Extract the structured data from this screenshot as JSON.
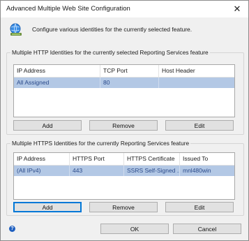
{
  "window": {
    "title": "Advanced Multiple Web Site Configuration",
    "close_glyph": "✕"
  },
  "header": {
    "icon": "globe-config-icon",
    "text": "Configure various identities for the currently selected feature."
  },
  "http_group": {
    "label": "Multiple HTTP Identities for the currently selected Reporting Services feature",
    "columns": [
      "IP Address",
      "TCP Port",
      "Host Header"
    ],
    "rows": [
      {
        "ip": "All Assigned",
        "port": "80",
        "host": ""
      }
    ],
    "add_label": "Add",
    "remove_label": "Remove",
    "edit_label": "Edit"
  },
  "https_group": {
    "label": "Multiple HTTPS Identities for the currently Reporting Services feature",
    "columns": [
      "IP Address",
      "HTTPS Port",
      "HTTPS Certificate",
      "Issued To"
    ],
    "rows": [
      {
        "ip": "(All IPv4)",
        "port": "443",
        "certificate": "SSRS Self-Signed ...",
        "issued_to": "mnl480win"
      }
    ],
    "add_label": "Add",
    "remove_label": "Remove",
    "edit_label": "Edit"
  },
  "footer": {
    "help_icon": "help-icon",
    "help_glyph": "?",
    "ok_label": "OK",
    "cancel_label": "Cancel"
  }
}
